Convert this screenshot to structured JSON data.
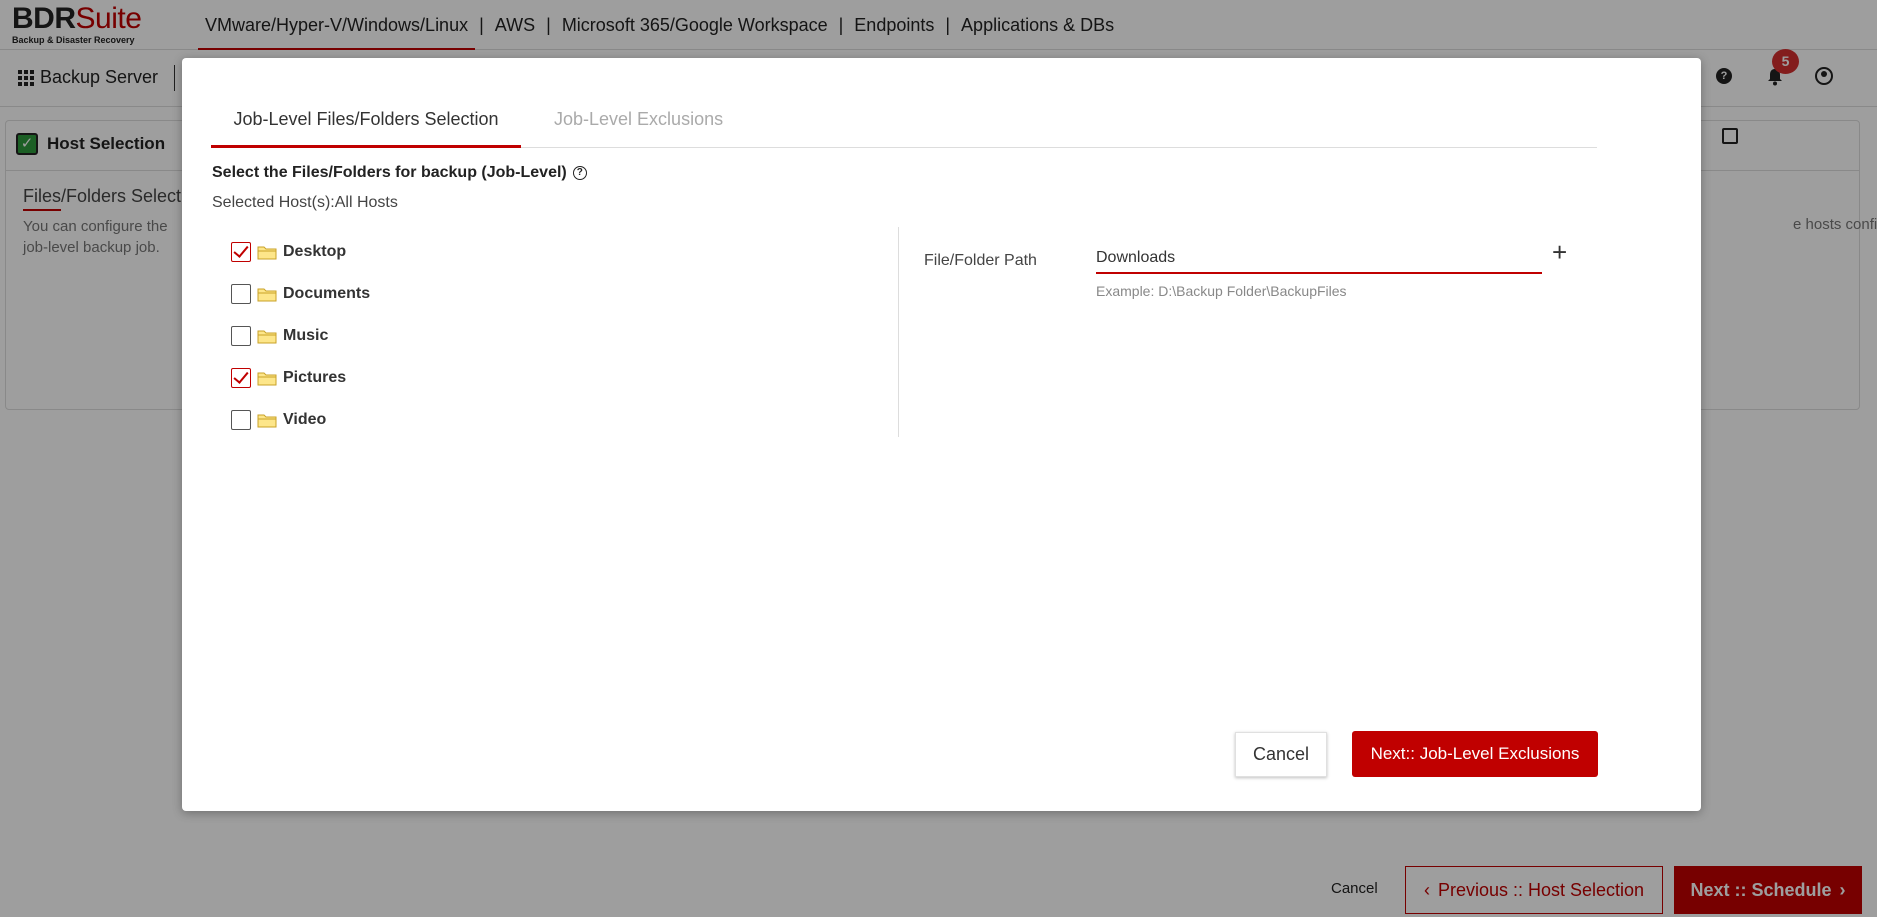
{
  "app": {
    "logo_main_bdr": "BDR",
    "logo_main_suite": "Suite",
    "logo_sub": "Backup & Disaster Recovery"
  },
  "topnav": {
    "items": [
      "VMware/Hyper-V/Windows/Linux",
      "AWS",
      "Microsoft 365/Google Workspace",
      "Endpoints",
      "Applications & DBs"
    ],
    "separator": "|"
  },
  "subbar": {
    "backup_server": "Backup Server",
    "notifications_count": "5"
  },
  "background": {
    "step_label": "Host Selection",
    "section_title": "Files/Folders Selection",
    "desc_left": "You can configure the job-level backup job.",
    "desc_right": "e hosts configured in this",
    "footer_cancel": "Cancel",
    "footer_prev": "Previous :: Host Selection",
    "footer_next": "Next :: Schedule"
  },
  "modal": {
    "tabs": [
      {
        "label": "Job-Level Files/Folders Selection",
        "active": true
      },
      {
        "label": "Job-Level Exclusions",
        "active": false
      }
    ],
    "select_title": "Select the Files/Folders for backup (Job-Level)",
    "selected_hosts": "Selected Host(s):All Hosts",
    "folders": [
      {
        "name": "Desktop",
        "checked": true
      },
      {
        "name": "Documents",
        "checked": false
      },
      {
        "name": "Music",
        "checked": false
      },
      {
        "name": "Pictures",
        "checked": true
      },
      {
        "name": "Video",
        "checked": false
      }
    ],
    "path_label": "File/Folder Path",
    "path_value": "Downloads",
    "path_example": "Example: D:\\Backup Folder\\BackupFiles",
    "cancel_label": "Cancel",
    "next_label": "Next:: Job-Level Exclusions"
  },
  "colors": {
    "accent": "#c00000",
    "success": "#2e9a3c"
  }
}
